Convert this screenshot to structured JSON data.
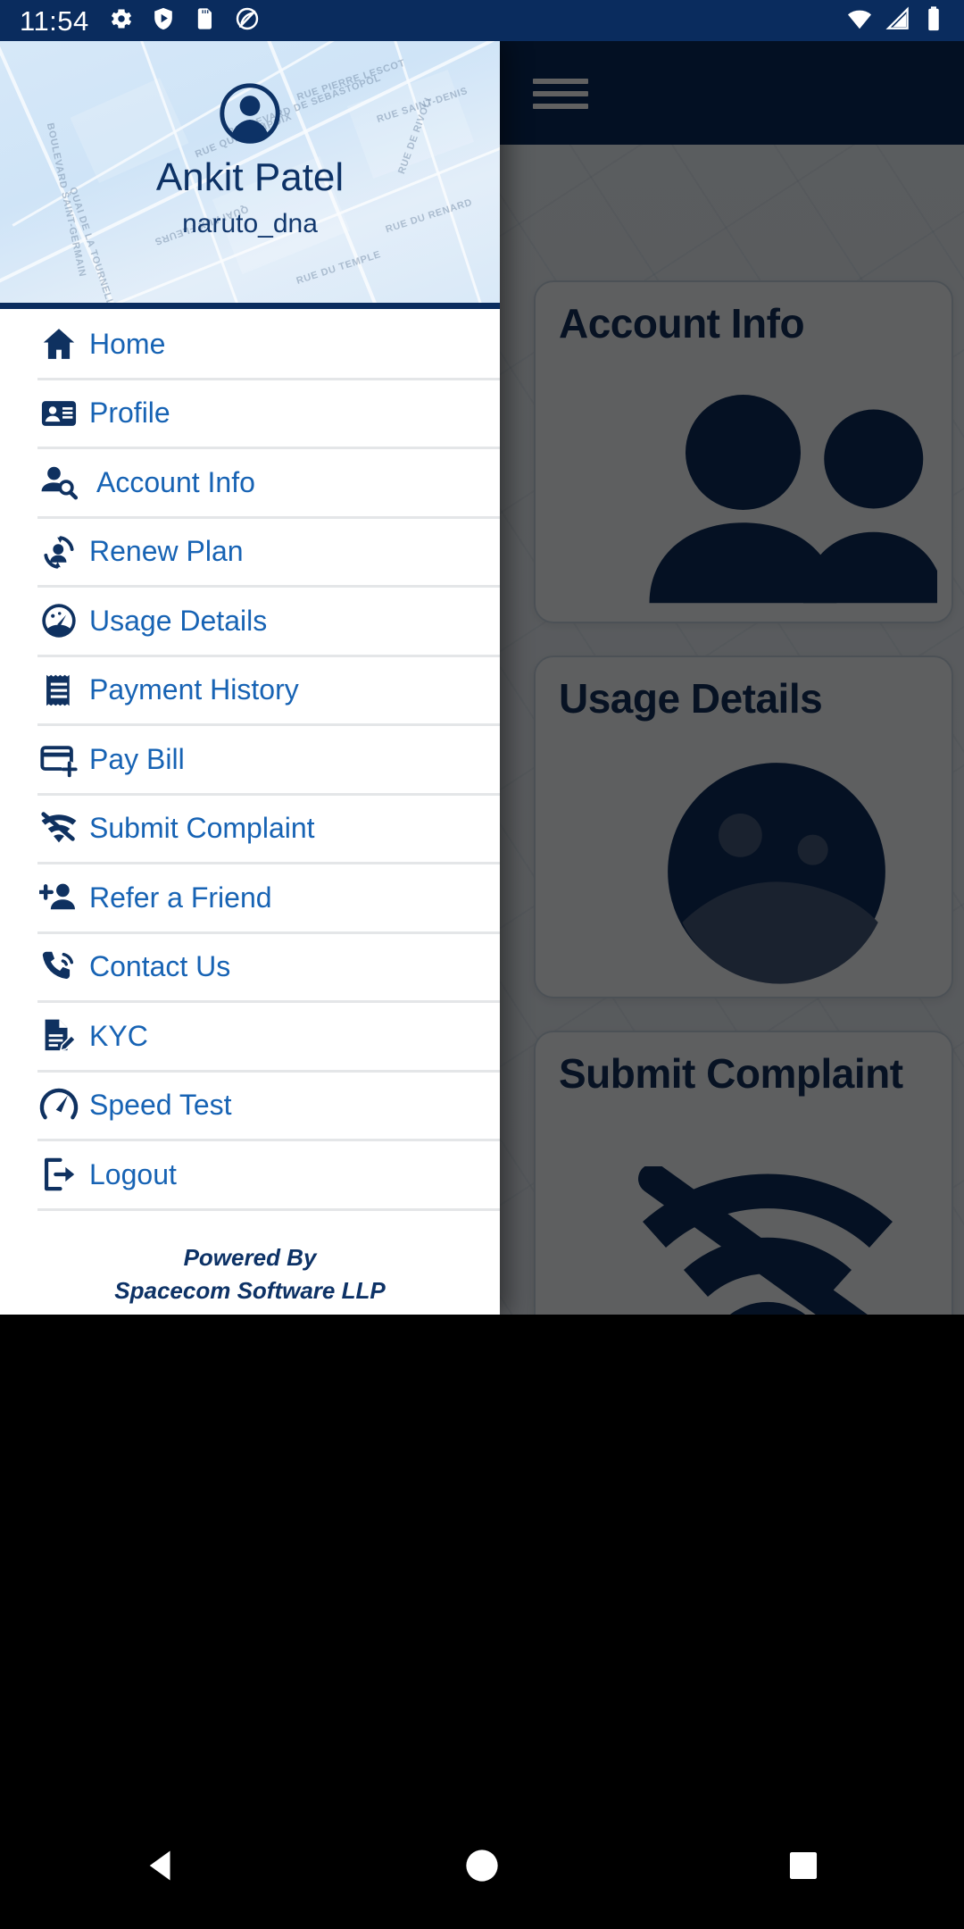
{
  "status_bar": {
    "time": "11:54",
    "left_icons": [
      "settings-gear-icon",
      "play-shield-icon",
      "sd-card-icon",
      "do-not-disturb-icon"
    ],
    "right_icons": [
      "wifi-icon",
      "cellular-signal-icon",
      "battery-icon"
    ],
    "background_color": "#0a2c5e"
  },
  "drawer": {
    "header": {
      "avatar_icon": "user-avatar-icon",
      "name": "Ankit Patel",
      "username": "naruto_dna",
      "map_labels": [
        "RUE PIERRE LESCOT",
        "RUE SAINT-DENIS",
        "BOULEVARD DE SEBASTOPOL",
        "RUE QUINCAMPOIX",
        "RUE DU TEMPLE",
        "RUE DU RENARD",
        "QUAI AUX FLEURS",
        "QUAI DE LA TOURNELLE",
        "BOULEVARD SAINT-GERMAIN",
        "RUE DE RIVOLI"
      ],
      "accent_color": "#0a2c5e",
      "name_color": "#0d3266"
    },
    "menu_items": [
      {
        "label": "Home",
        "icon": "home-icon",
        "indent": false
      },
      {
        "label": "Profile",
        "icon": "contact-card-icon",
        "indent": false
      },
      {
        "label": "Account Info",
        "icon": "person-search-icon",
        "indent": true
      },
      {
        "label": "Renew Plan",
        "icon": "person-refresh-icon",
        "indent": false
      },
      {
        "label": "Usage Details",
        "icon": "gauge-filled-icon",
        "indent": false
      },
      {
        "label": "Payment History",
        "icon": "receipt-icon",
        "indent": false
      },
      {
        "label": "Pay Bill",
        "icon": "card-add-icon",
        "indent": false
      },
      {
        "label": "Submit Complaint",
        "icon": "wifi-off-icon",
        "indent": false
      },
      {
        "label": "Refer a Friend",
        "icon": "person-add-icon",
        "indent": false
      },
      {
        "label": "Contact Us",
        "icon": "phone-ring-icon",
        "indent": false
      },
      {
        "label": "KYC",
        "icon": "document-edit-icon",
        "indent": false
      },
      {
        "label": "Speed Test",
        "icon": "speedometer-icon",
        "indent": false
      },
      {
        "label": "Logout",
        "icon": "logout-icon",
        "indent": false
      }
    ],
    "menu_label_color": "#1763b4",
    "menu_icon_color": "#0f3160",
    "footer": {
      "line1": "Powered By",
      "line2": "Spacecom Software LLP"
    }
  },
  "background_app": {
    "menu_button_icon": "hamburger-menu-icon",
    "cards": [
      {
        "title": "Account Info",
        "glyph": "people-icon"
      },
      {
        "title": "Usage Details",
        "glyph": "pie-chart-icon"
      },
      {
        "title": "Submit Complaint",
        "glyph": "wifi-off-icon"
      }
    ]
  },
  "nav_bar": {
    "buttons": [
      "back-triangle-icon",
      "home-circle-icon",
      "recents-square-icon"
    ]
  }
}
